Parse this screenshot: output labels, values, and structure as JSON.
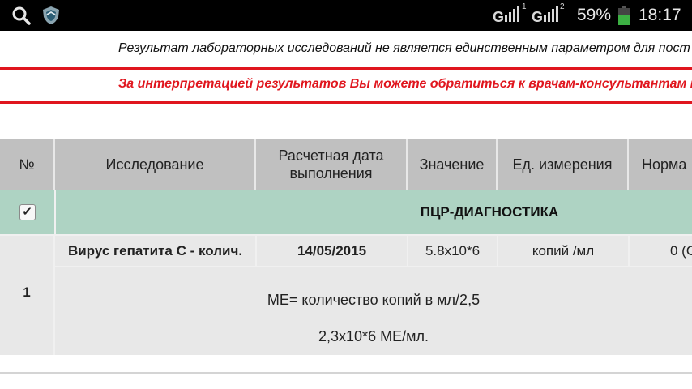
{
  "status_bar": {
    "icons": [
      "search-icon",
      "shield-icon",
      "signal-sim1-icon",
      "signal-sim2-icon",
      "battery-icon"
    ],
    "sim1_label": "1",
    "sim2_label": "2",
    "battery_percent": "59%",
    "battery_level": 0.59,
    "time": "18:17",
    "battery_color": "#3cb043"
  },
  "notices": {
    "line1": "Результат лабораторных исследований не является единственным параметром для пост",
    "line2": "За интерпретацией результатов Вы можете обратиться к врачам-консультантам нашего",
    "accent_color": "#e0161e"
  },
  "table": {
    "headers": {
      "number": "№",
      "study": "Исследование",
      "date_line1": "Расчетная дата",
      "date_line2": "выполнения",
      "value": "Значение",
      "unit": "Ед. измерения",
      "norm": "Норма"
    },
    "group": {
      "title": "ПЦР-ДИАГНОСТИКА",
      "checked": true,
      "color": "#aed3c3"
    },
    "rows": [
      {
        "number": "1",
        "study": "Вирус гепатита С - колич.",
        "date": "14/05/2015",
        "value": "5.8x10*6",
        "unit": "копий /мл",
        "norm": "0 (О",
        "note_line1": "МЕ= количество копий в мл/2,5",
        "note_line2": "2,3x10*6 МЕ/мл."
      }
    ]
  }
}
